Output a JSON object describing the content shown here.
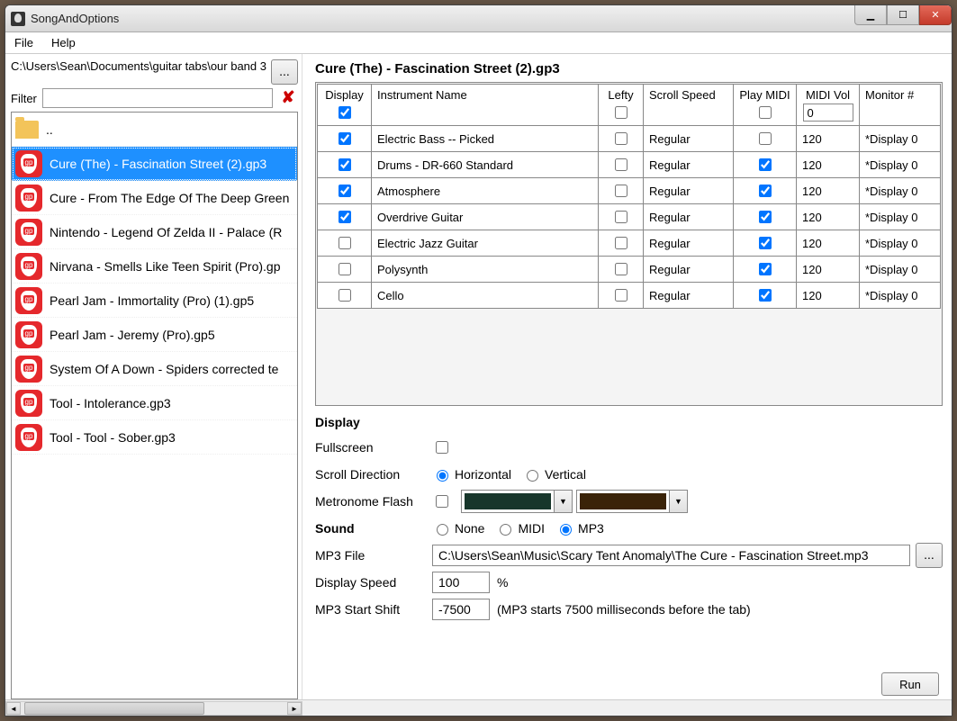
{
  "window": {
    "title": "SongAndOptions"
  },
  "menu": {
    "file": "File",
    "help": "Help"
  },
  "sidebar": {
    "path": "C:\\Users\\Sean\\Documents\\guitar tabs\\our band 3",
    "browse_btn": "...",
    "filter_label": "Filter",
    "filter_value": "",
    "items": [
      {
        "type": "up",
        "label": ".."
      },
      {
        "type": "file",
        "label": "Cure (The) - Fascination Street (2).gp3",
        "selected": true
      },
      {
        "type": "file",
        "label": "Cure - From The Edge Of The Deep Green"
      },
      {
        "type": "file",
        "label": "Nintendo - Legend Of Zelda II - Palace (R"
      },
      {
        "type": "file",
        "label": "Nirvana - Smells Like Teen Spirit (Pro).gp"
      },
      {
        "type": "file",
        "label": "Pearl Jam - Immortality (Pro) (1).gp5"
      },
      {
        "type": "file",
        "label": "Pearl Jam - Jeremy (Pro).gp5"
      },
      {
        "type": "file",
        "label": "System Of A Down - Spiders corrected te"
      },
      {
        "type": "file",
        "label": "Tool - Intolerance.gp3"
      },
      {
        "type": "file",
        "label": "Tool - Tool - Sober.gp3"
      }
    ]
  },
  "song": {
    "title": "Cure (The) - Fascination Street (2).gp3",
    "columns": {
      "display": "Display",
      "instrument": "Instrument Name",
      "lefty": "Lefty",
      "speed": "Scroll Speed",
      "midi": "Play MIDI",
      "vol": "MIDI Vol",
      "monitor": "Monitor #"
    },
    "header_vol": "0",
    "rows": [
      {
        "display": true,
        "name": "Electric Bass -- Picked",
        "lefty": false,
        "speed": "Regular",
        "midi": false,
        "vol": "120",
        "monitor": "*Display 0"
      },
      {
        "display": true,
        "name": "Drums - DR-660 Standard",
        "lefty": false,
        "speed": "Regular",
        "midi": true,
        "vol": "120",
        "monitor": "*Display 0"
      },
      {
        "display": true,
        "name": "Atmosphere",
        "lefty": false,
        "speed": "Regular",
        "midi": true,
        "vol": "120",
        "monitor": "*Display 0"
      },
      {
        "display": true,
        "name": "Overdrive Guitar",
        "lefty": false,
        "speed": "Regular",
        "midi": true,
        "vol": "120",
        "monitor": "*Display 0"
      },
      {
        "display": false,
        "name": "Electric Jazz Guitar",
        "lefty": false,
        "speed": "Regular",
        "midi": true,
        "vol": "120",
        "monitor": "*Display 0"
      },
      {
        "display": false,
        "name": "Polysynth",
        "lefty": false,
        "speed": "Regular",
        "midi": true,
        "vol": "120",
        "monitor": "*Display 0"
      },
      {
        "display": false,
        "name": "Cello",
        "lefty": false,
        "speed": "Regular",
        "midi": true,
        "vol": "120",
        "monitor": "*Display 0"
      }
    ]
  },
  "display": {
    "section": "Display",
    "fullscreen_label": "Fullscreen",
    "scroll_dir_label": "Scroll Direction",
    "horizontal": "Horizontal",
    "vertical": "Vertical",
    "metronome_label": "Metronome Flash",
    "color1": "#17362b",
    "color2": "#3a2308",
    "sound_section": "Sound",
    "none": "None",
    "midi": "MIDI",
    "mp3": "MP3",
    "mp3_file_label": "MP3 File",
    "mp3_path": "C:\\Users\\Sean\\Music\\Scary Tent Anomaly\\The Cure - Fascination Street.mp3",
    "browse": "...",
    "speed_label": "Display Speed",
    "speed_value": "100",
    "speed_unit": "%",
    "shift_label": "MP3 Start Shift",
    "shift_value": "-7500",
    "shift_hint": "(MP3 starts 7500 milliseconds before the tab)"
  },
  "run_label": "Run"
}
